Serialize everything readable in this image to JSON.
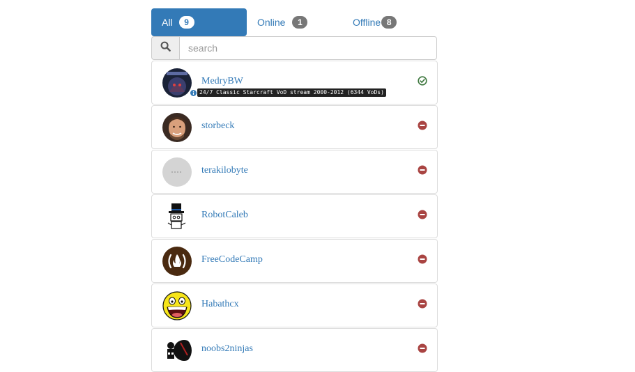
{
  "tabs": [
    {
      "label": "All",
      "count": "9"
    },
    {
      "label": "Online",
      "count": "1"
    },
    {
      "label": "Offline",
      "count": "8"
    }
  ],
  "search": {
    "placeholder": "search",
    "icon": "search-icon"
  },
  "channels": [
    {
      "name": "MedryBW",
      "status": "online",
      "stream": "24/7 Classic Starcraft VoD stream 2000-2012 (6344 VoDs)"
    },
    {
      "name": "storbeck",
      "status": "offline"
    },
    {
      "name": "terakilobyte",
      "status": "offline"
    },
    {
      "name": "RobotCaleb",
      "status": "offline"
    },
    {
      "name": "FreeCodeCamp",
      "status": "offline"
    },
    {
      "name": "Habathcx",
      "status": "offline"
    },
    {
      "name": "noobs2ninjas",
      "status": "offline"
    }
  ],
  "colors": {
    "accent": "#337ab7",
    "online": "#3c763d",
    "offline": "#a94442"
  }
}
